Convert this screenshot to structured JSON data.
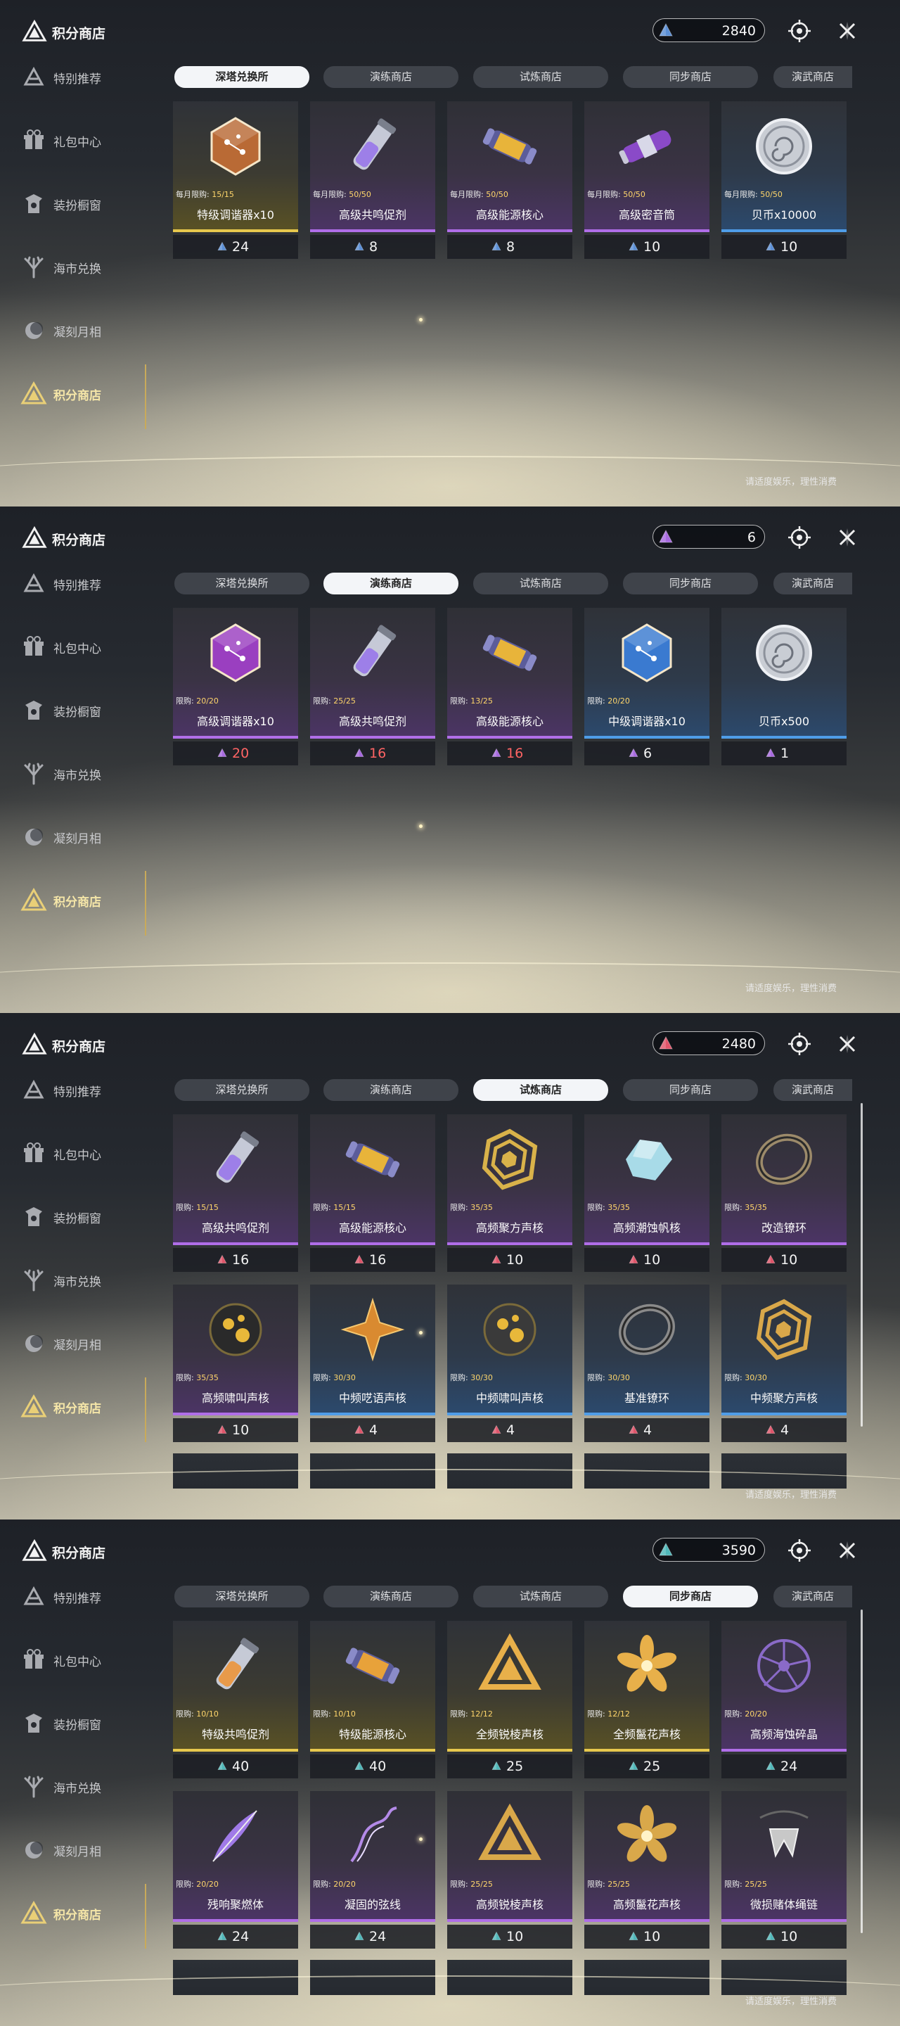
{
  "panels": [
    {
      "title": "积分商店",
      "currency": {
        "amount": "2840",
        "icon": "blue-crystal-icon",
        "color": "#5b8fd6"
      },
      "sidebar": [
        {
          "label": "特别推荐",
          "icon": "star-recommend-icon"
        },
        {
          "label": "礼包中心",
          "icon": "gift-icon"
        },
        {
          "label": "装扮橱窗",
          "icon": "wardrobe-icon"
        },
        {
          "label": "海市兑换",
          "icon": "coral-icon"
        },
        {
          "label": "凝刻月相",
          "icon": "moon-phase-icon"
        },
        {
          "label": "积分商店",
          "icon": "points-shop-icon"
        }
      ],
      "tabs": [
        "深塔兑换所",
        "演练商店",
        "试炼商店",
        "同步商店",
        "演武商店"
      ],
      "active_tab": 0,
      "items": [
        {
          "name": "特级调谐器x10",
          "limit_label": "每月限购:",
          "limit": "15/15",
          "price": "24",
          "rarity": "gold",
          "art": "tuner-icon",
          "art_color": "#b96a35"
        },
        {
          "name": "高级共鸣促剂",
          "limit_label": "每月限购:",
          "limit": "50/50",
          "price": "8",
          "rarity": "purple",
          "art": "potion-vial-icon",
          "art_color": "#9d7fe8"
        },
        {
          "name": "高级能源核心",
          "limit_label": "每月限购:",
          "limit": "50/50",
          "price": "8",
          "rarity": "purple",
          "art": "energy-core-icon",
          "art_color": "#e8b43a"
        },
        {
          "name": "高级密音筒",
          "limit_label": "每月限购:",
          "limit": "50/50",
          "price": "10",
          "rarity": "purple",
          "art": "sound-tube-icon",
          "art_color": "#8a4ac8"
        },
        {
          "name": "贝币x10000",
          "limit_label": "每月限购:",
          "limit": "50/50",
          "price": "10",
          "rarity": "blue",
          "art": "shell-coin-icon",
          "art_color": "#c9cdd4"
        }
      ],
      "footer": "请适度娱乐，理性消费"
    },
    {
      "title": "积分商店",
      "currency": {
        "amount": "6",
        "icon": "purple-crystal-icon",
        "color": "#a86ae0"
      },
      "sidebar": [
        {
          "label": "特别推荐",
          "icon": "star-recommend-icon"
        },
        {
          "label": "礼包中心",
          "icon": "gift-icon"
        },
        {
          "label": "装扮橱窗",
          "icon": "wardrobe-icon"
        },
        {
          "label": "海市兑换",
          "icon": "coral-icon"
        },
        {
          "label": "凝刻月相",
          "icon": "moon-phase-icon"
        },
        {
          "label": "积分商店",
          "icon": "points-shop-icon"
        }
      ],
      "tabs": [
        "深塔兑换所",
        "演练商店",
        "试炼商店",
        "同步商店",
        "演武商店"
      ],
      "active_tab": 1,
      "items": [
        {
          "name": "高级调谐器x10",
          "limit_label": "限购:",
          "limit": "20/20",
          "price": "20",
          "price_red": true,
          "rarity": "purple",
          "art": "tuner-icon",
          "art_color": "#9a3fc0"
        },
        {
          "name": "高级共鸣促剂",
          "limit_label": "限购:",
          "limit": "25/25",
          "price": "16",
          "price_red": true,
          "rarity": "purple",
          "art": "potion-vial-icon",
          "art_color": "#9d7fe8"
        },
        {
          "name": "高级能源核心",
          "limit_label": "限购:",
          "limit": "13/25",
          "price": "16",
          "price_red": true,
          "rarity": "purple",
          "art": "energy-core-icon",
          "art_color": "#e8b43a"
        },
        {
          "name": "中级调谐器x10",
          "limit_label": "限购:",
          "limit": "20/20",
          "price": "6",
          "rarity": "blue",
          "art": "tuner-icon",
          "art_color": "#3a7ad0"
        },
        {
          "name": "贝币x500",
          "limit_label": "",
          "limit": "",
          "price": "1",
          "rarity": "blue",
          "art": "shell-coin-icon",
          "art_color": "#c9cdd4"
        }
      ],
      "footer": "请适度娱乐，理性消费"
    },
    {
      "title": "积分商店",
      "currency": {
        "amount": "2480",
        "icon": "red-crystal-icon",
        "color": "#e0556a"
      },
      "sidebar": [
        {
          "label": "特别推荐",
          "icon": "star-recommend-icon"
        },
        {
          "label": "礼包中心",
          "icon": "gift-icon"
        },
        {
          "label": "装扮橱窗",
          "icon": "wardrobe-icon"
        },
        {
          "label": "海市兑换",
          "icon": "coral-icon"
        },
        {
          "label": "凝刻月相",
          "icon": "moon-phase-icon"
        },
        {
          "label": "积分商店",
          "icon": "points-shop-icon"
        }
      ],
      "tabs": [
        "深塔兑换所",
        "演练商店",
        "试炼商店",
        "同步商店",
        "演武商店"
      ],
      "active_tab": 2,
      "items": [
        {
          "name": "高级共鸣促剂",
          "limit_label": "限购:",
          "limit": "15/15",
          "price": "16",
          "rarity": "purple",
          "art": "potion-vial-icon",
          "art_color": "#9d7fe8"
        },
        {
          "name": "高级能源核心",
          "limit_label": "限购:",
          "limit": "15/15",
          "price": "16",
          "rarity": "purple",
          "art": "energy-core-icon",
          "art_color": "#e8b43a"
        },
        {
          "name": "高频聚方声核",
          "limit_label": "限购:",
          "limit": "35/35",
          "price": "10",
          "rarity": "purple",
          "art": "gold-hexagon-icon",
          "art_color": "#d9b24a"
        },
        {
          "name": "高频潮蚀帆核",
          "limit_label": "限购:",
          "limit": "35/35",
          "price": "10",
          "rarity": "purple",
          "art": "crystal-icon",
          "art_color": "#a8dbe8"
        },
        {
          "name": "改造镣环",
          "limit_label": "限购:",
          "limit": "35/35",
          "price": "10",
          "rarity": "purple",
          "art": "ring-icon",
          "art_color": "#9c8a6a"
        },
        {
          "name": "高频啸叫声核",
          "limit_label": "限购:",
          "limit": "35/35",
          "price": "10",
          "rarity": "purple",
          "art": "dark-orb-icon",
          "art_color": "#2a2a2a"
        },
        {
          "name": "中频呓语声核",
          "limit_label": "限购:",
          "limit": "30/30",
          "price": "4",
          "rarity": "blue",
          "art": "four-point-star-icon",
          "art_color": "#d98a30"
        },
        {
          "name": "中频啸叫声核",
          "limit_label": "限购:",
          "limit": "30/30",
          "price": "4",
          "rarity": "blue",
          "art": "dark-orb-icon",
          "art_color": "#3a3a3a"
        },
        {
          "name": "基准镣环",
          "limit_label": "限购:",
          "limit": "30/30",
          "price": "4",
          "rarity": "blue",
          "art": "ring-icon",
          "art_color": "#8a8a8a"
        },
        {
          "name": "中频聚方声核",
          "limit_label": "限购:",
          "limit": "30/30",
          "price": "4",
          "rarity": "blue",
          "art": "gold-hexagon-icon",
          "art_color": "#d9a84a"
        }
      ],
      "footer": "请适度娱乐，理性消费"
    },
    {
      "title": "积分商店",
      "currency": {
        "amount": "3590",
        "icon": "teal-crystal-icon",
        "color": "#4fb7b9"
      },
      "sidebar": [
        {
          "label": "特别推荐",
          "icon": "star-recommend-icon"
        },
        {
          "label": "礼包中心",
          "icon": "gift-icon"
        },
        {
          "label": "装扮橱窗",
          "icon": "wardrobe-icon"
        },
        {
          "label": "海市兑换",
          "icon": "coral-icon"
        },
        {
          "label": "凝刻月相",
          "icon": "moon-phase-icon"
        },
        {
          "label": "积分商店",
          "icon": "points-shop-icon"
        }
      ],
      "tabs": [
        "深塔兑换所",
        "演练商店",
        "试炼商店",
        "同步商店",
        "演武商店"
      ],
      "active_tab": 3,
      "items": [
        {
          "name": "特级共鸣促剂",
          "limit_label": "限购:",
          "limit": "10/10",
          "price": "40",
          "rarity": "gold",
          "art": "potion-vial-icon",
          "art_color": "#e89a4a"
        },
        {
          "name": "特级能源核心",
          "limit_label": "限购:",
          "limit": "10/10",
          "price": "40",
          "rarity": "gold",
          "art": "energy-core-icon",
          "art_color": "#e8a23a"
        },
        {
          "name": "全频锐棱声核",
          "limit_label": "限购:",
          "limit": "12/12",
          "price": "25",
          "rarity": "gold",
          "art": "triangle-core-icon",
          "art_color": "#e8b04a"
        },
        {
          "name": "全频鬣花声核",
          "limit_label": "限购:",
          "limit": "12/12",
          "price": "25",
          "rarity": "gold",
          "art": "flower-core-icon",
          "art_color": "#e8b04a"
        },
        {
          "name": "高频海蚀碎晶",
          "limit_label": "限购:",
          "limit": "20/20",
          "price": "24",
          "rarity": "purple",
          "art": "shard-disc-icon",
          "art_color": "#8a6ac8"
        },
        {
          "name": "残响聚燃体",
          "limit_label": "限购:",
          "limit": "20/20",
          "price": "24",
          "rarity": "purple",
          "art": "feather-quill-icon",
          "art_color": "#a07ae8"
        },
        {
          "name": "凝固的弦线",
          "limit_label": "限购:",
          "limit": "20/20",
          "price": "24",
          "rarity": "purple",
          "art": "string-wisp-icon",
          "art_color": "#b48ae8"
        },
        {
          "name": "高频锐棱声核",
          "limit_label": "限购:",
          "limit": "25/25",
          "price": "10",
          "rarity": "purple",
          "art": "triangle-core-icon",
          "art_color": "#d9a84a"
        },
        {
          "name": "高频鬣花声核",
          "limit_label": "限购:",
          "limit": "25/25",
          "price": "10",
          "rarity": "purple",
          "art": "flower-core-icon",
          "art_color": "#d9a84a"
        },
        {
          "name": "微损赌体绳链",
          "limit_label": "限购:",
          "limit": "25/25",
          "price": "10",
          "rarity": "purple",
          "art": "chain-pendant-icon",
          "art_color": "#c8c8c8"
        }
      ],
      "footer": "请适度娱乐，理性消费"
    }
  ]
}
